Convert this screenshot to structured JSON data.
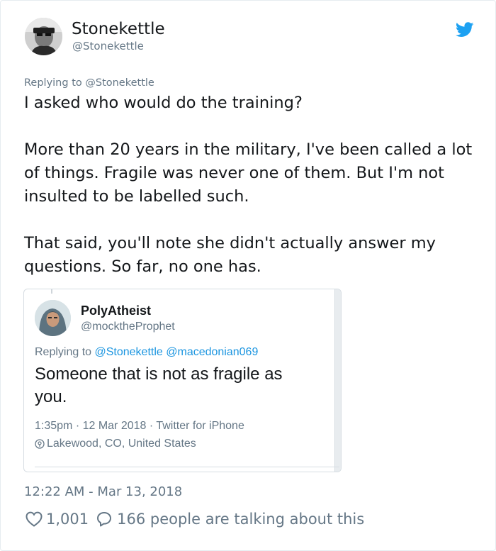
{
  "tweet": {
    "author_name": "Stonekettle",
    "author_handle": "@Stonekettle",
    "replying_prefix": "Replying to",
    "replying_to": "@Stonekettle",
    "text_line1": "I asked who would do the training?",
    "paragraph2": "More than 20 years in the military, I've been called a lot of things. Fragile was never one of them. But I'm not insulted to be labelled such.",
    "paragraph3": "That said, you'll note she didn't actually answer my questions. So far, no one has.",
    "timestamp": "12:22 AM - Mar 13, 2018",
    "likes": "1,001",
    "talking": "166 people are talking about this",
    "icons": {
      "brand": "twitter-bird-icon",
      "like": "heart-icon",
      "reply": "speech-bubble-icon"
    },
    "colors": {
      "brand": "#1da1f2",
      "muted": "#657786",
      "link": "#1b95e0"
    }
  },
  "quoted": {
    "author_name": "PolyAtheist",
    "author_handle": "@mocktheProphet",
    "replying_prefix": "Replying to",
    "replying_to": "@Stonekettle @macedonian069",
    "text": "Someone that is not as fragile as you.",
    "meta": "1:35pm · 12 Mar 2018 · Twitter for iPhone",
    "location": "Lakewood, CO, United States",
    "icons": {
      "location": "location-pin-icon"
    }
  }
}
